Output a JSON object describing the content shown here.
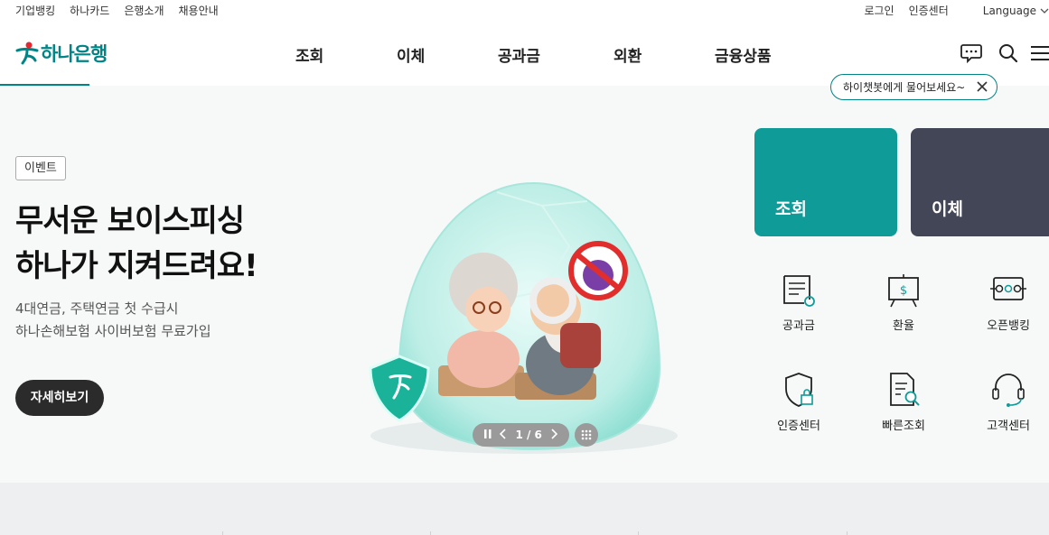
{
  "util_left": [
    "기업뱅킹",
    "하나카드",
    "은행소개",
    "채용안내"
  ],
  "util_right": [
    "로그인",
    "인증센터"
  ],
  "language_label": "Language",
  "logo_text": "하나은행",
  "menu": [
    "조회",
    "이체",
    "공과금",
    "외환",
    "금융상품"
  ],
  "gnb_icons": [
    "chat-icon",
    "search-icon",
    "menu-icon"
  ],
  "chat_tip": {
    "text": "하이챗봇에게 물어보세요~",
    "close_icon": "close-icon"
  },
  "hero": {
    "badge": "이벤트",
    "headline": [
      "무서운 보이스피싱",
      "하나가 지켜드려요!"
    ],
    "sub": [
      "4대연금, 주택연금 첫 수급시",
      "하나손해보험 사이버보험 무료가입"
    ],
    "detail_button": "자세히보기",
    "pager": {
      "current": "1",
      "total": "6",
      "display": "1 / 6"
    }
  },
  "cards": [
    {
      "label": "조회",
      "color": "#0f9b98"
    },
    {
      "label": "이체",
      "color": "#434656"
    }
  ],
  "quick_links": [
    {
      "label": "공과금",
      "icon": "bill-icon"
    },
    {
      "label": "환율",
      "icon": "exchange-board-icon"
    },
    {
      "label": "오픈뱅킹",
      "icon": "open-banking-icon"
    },
    {
      "label": "인증센터",
      "icon": "shield-lock-icon"
    },
    {
      "label": "빠른조회",
      "icon": "document-search-icon"
    },
    {
      "label": "고객센터",
      "icon": "headset-icon"
    }
  ],
  "colors": {
    "brand": "#008485",
    "dark_card": "#434656",
    "button": "#2b2b2b"
  }
}
